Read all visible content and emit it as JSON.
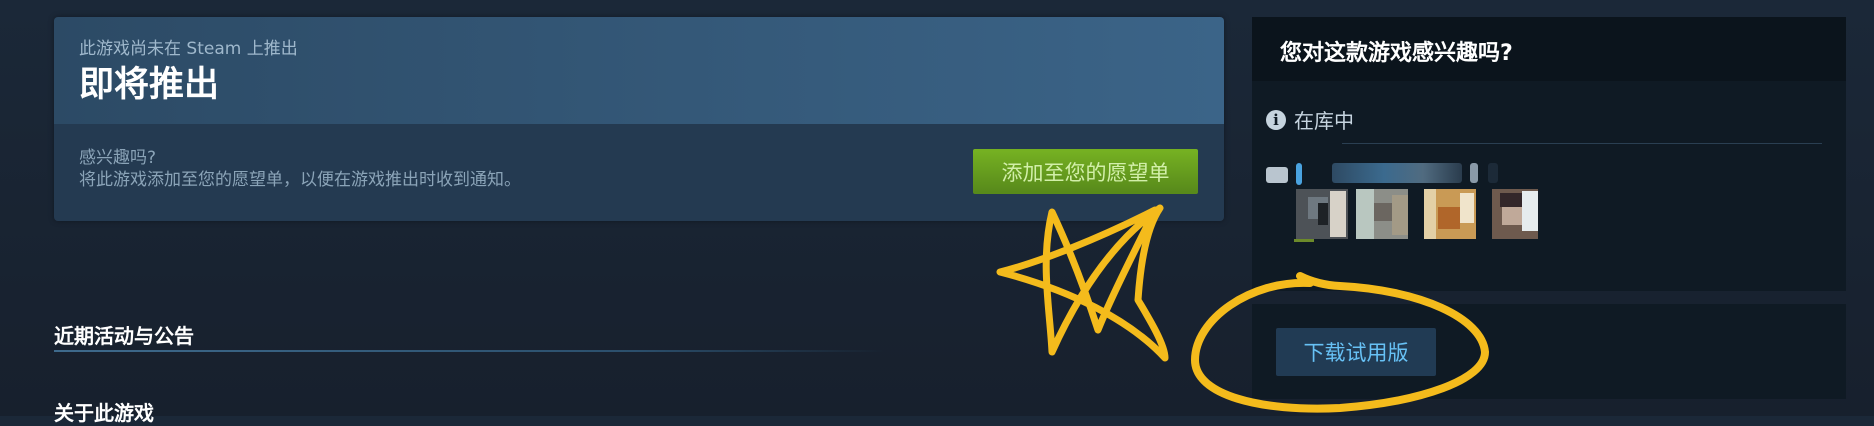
{
  "coming_soon": {
    "subtitle": "此游戏尚未在 Steam 上推出",
    "title": "即将推出",
    "interest_line1": "感兴趣吗?",
    "interest_line2": "将此游戏添加至您的愿望单，以便在游戏推出时收到通知。",
    "wishlist_button": "添加至您的愿望单"
  },
  "sections": {
    "news": "近期活动与公告",
    "about": "关于此游戏"
  },
  "interest_panel": {
    "title": "您对这款游戏感兴趣吗?",
    "in_library": "在库中",
    "info_icon": "info-icon",
    "demo_button": "下载试用版"
  },
  "colors": {
    "wishlist_green": "#75b022",
    "demo_blue": "#67c1f5",
    "doodle_yellow": "#f4bb1c"
  }
}
